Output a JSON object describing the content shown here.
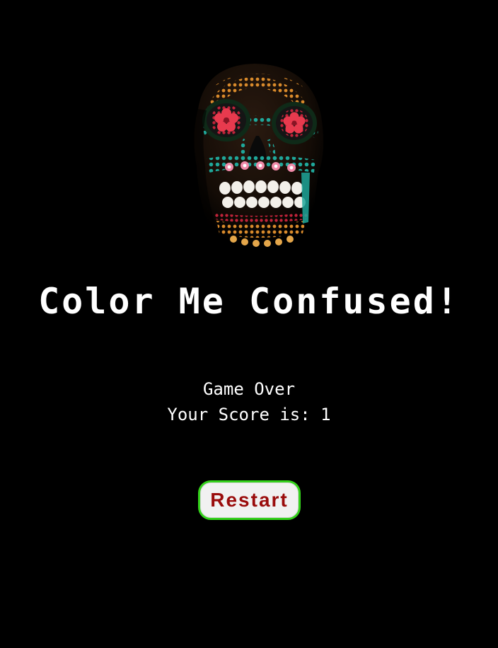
{
  "hero": {
    "image": "decorated-sugar-skull",
    "colors": {
      "background": "#000000",
      "title_text": "#ffffff",
      "button_border": "#35d21c",
      "button_fill": "#f1f1f1",
      "button_text": "#9a0c0c"
    }
  },
  "game": {
    "title": "Color Me Confused!",
    "status": "Game Over",
    "score_line": "Your Score is: 1"
  },
  "controls": {
    "restart_label": "Restart"
  }
}
